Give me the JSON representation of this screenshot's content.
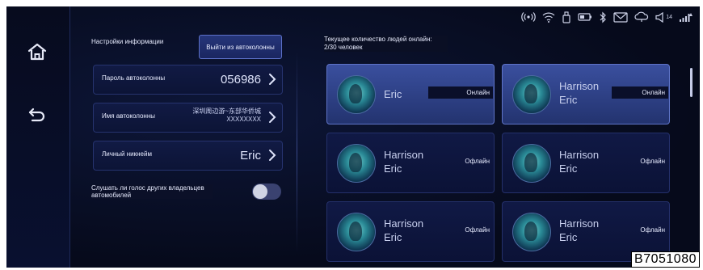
{
  "header": {
    "info_settings": "Настройки информации",
    "exit_button": "Выйти из автоколонны",
    "online_count_label": "Текущее количество людей онлайн:",
    "online_count_value": "2/30 человек"
  },
  "status": {
    "battery_number": "14"
  },
  "settings": {
    "password_label": "Пароль автоколонны",
    "password_value": "056986",
    "name_label": "Имя автоколонны",
    "name_value_line1": "深圳周边游~东部华侨城",
    "name_value_line2": "XXXXXXXX",
    "nickname_label": "Личный никнейм",
    "nickname_value": "Eric",
    "voice_label": "Слушать ли голос других владельцев автомобилей",
    "voice_enabled": false
  },
  "users": [
    {
      "line1": "Eric",
      "line2": "",
      "status": "Онлайн",
      "online": true
    },
    {
      "line1": "Harrison",
      "line2": "Eric",
      "status": "Онлайн",
      "online": true
    },
    {
      "line1": "Harrison",
      "line2": "Eric",
      "status": "Офлайн",
      "online": false
    },
    {
      "line1": "Harrison",
      "line2": "Eric",
      "status": "Офлайн",
      "online": false
    },
    {
      "line1": "Harrison",
      "line2": "Eric",
      "status": "Офлайн",
      "online": false
    },
    {
      "line1": "Harrison",
      "line2": "Eric",
      "status": "Офлайн",
      "online": false
    }
  ],
  "image_code": "B7051080"
}
